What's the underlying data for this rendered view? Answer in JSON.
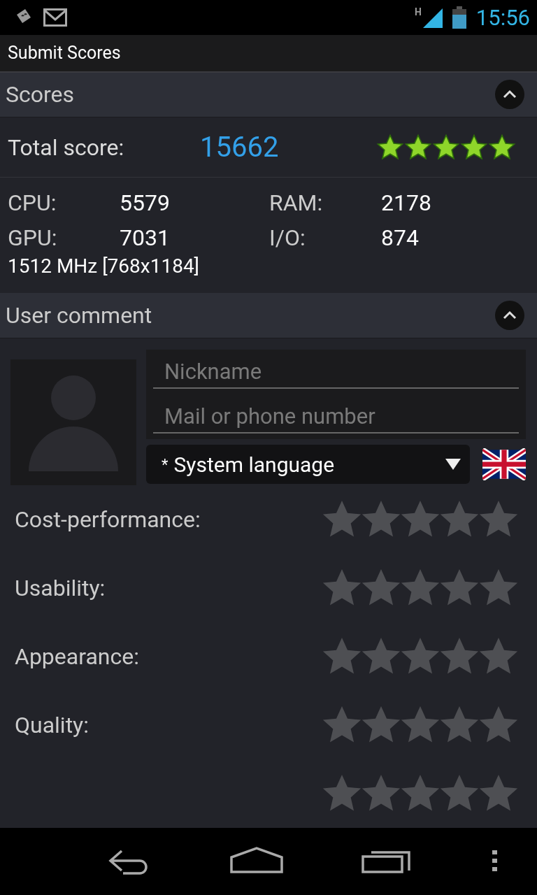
{
  "status_bar": {
    "time": "15:56",
    "network": "H"
  },
  "title": "Submit Scores",
  "scores": {
    "header": "Scores",
    "expanded": true,
    "total_label": "Total score:",
    "total": "15662",
    "stars": 5,
    "items": [
      {
        "label": "CPU:",
        "value": "5579"
      },
      {
        "label": "RAM:",
        "value": "2178"
      },
      {
        "label": "GPU:",
        "value": "7031"
      },
      {
        "label": "I/O:",
        "value": "874"
      }
    ],
    "device": "1512 MHz [768x1184]"
  },
  "comment": {
    "header": "User comment",
    "expanded": true,
    "nickname": {
      "placeholder": "Nickname"
    },
    "contact": {
      "placeholder": "Mail or phone number"
    },
    "language": {
      "marker": "*",
      "value": "System language"
    },
    "ratings": [
      {
        "label": "Cost-performance:",
        "stars": 0
      },
      {
        "label": "Usability:",
        "stars": 0
      },
      {
        "label": "Appearance:",
        "stars": 0
      },
      {
        "label": "Quality:",
        "stars": 0
      },
      {
        "stars": 0
      }
    ]
  }
}
